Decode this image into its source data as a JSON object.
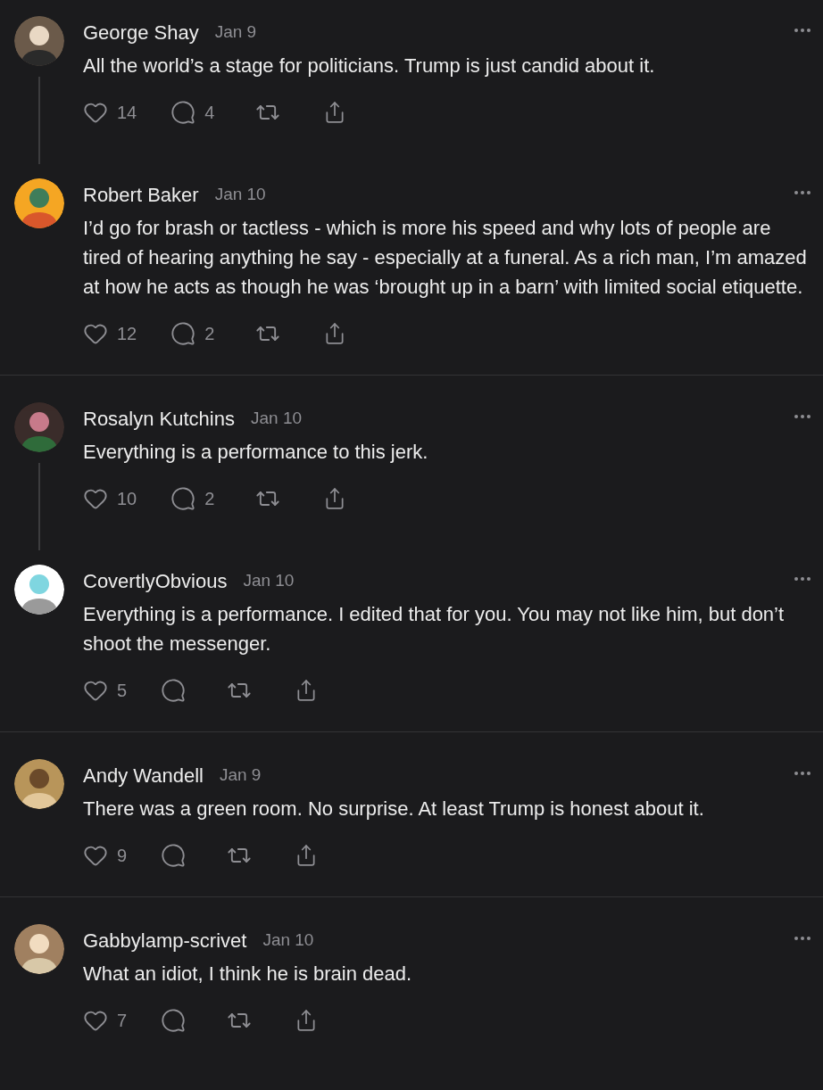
{
  "threads": [
    {
      "comments": [
        {
          "name": "George Shay",
          "date": "Jan 9",
          "text": "All the world’s a stage for politicians. Trump is just candid about it.",
          "likes": "14",
          "replies": "4"
        },
        {
          "name": "Robert Baker",
          "date": "Jan 10",
          "text": "I’d go for brash or tactless - which is more his speed and why lots of people are tired of hearing anything he say - especially at a funeral. As a rich man, I’m amazed at how he acts as though he was ‘brought up in a barn’ with limited social etiquette.",
          "likes": "12",
          "replies": "2"
        }
      ]
    },
    {
      "comments": [
        {
          "name": "Rosalyn Kutchins",
          "date": "Jan 10",
          "text": "Everything is a performance to this jerk.",
          "likes": "10",
          "replies": "2"
        },
        {
          "name": "CovertlyObvious",
          "date": "Jan 10",
          "text": "Everything is a performance. I edited that for you. You may not like him, but don’t shoot the messenger.",
          "likes": "5"
        }
      ]
    },
    {
      "comments": [
        {
          "name": "Andy Wandell",
          "date": "Jan 9",
          "text": "There was a green room. No surprise. At least Trump is honest about it.",
          "likes": "9"
        }
      ]
    },
    {
      "comments": [
        {
          "name": "Gabbylamp-scrivet",
          "date": "Jan 10",
          "text": "What an idiot, I think he is brain dead.",
          "likes": "7"
        }
      ]
    }
  ]
}
